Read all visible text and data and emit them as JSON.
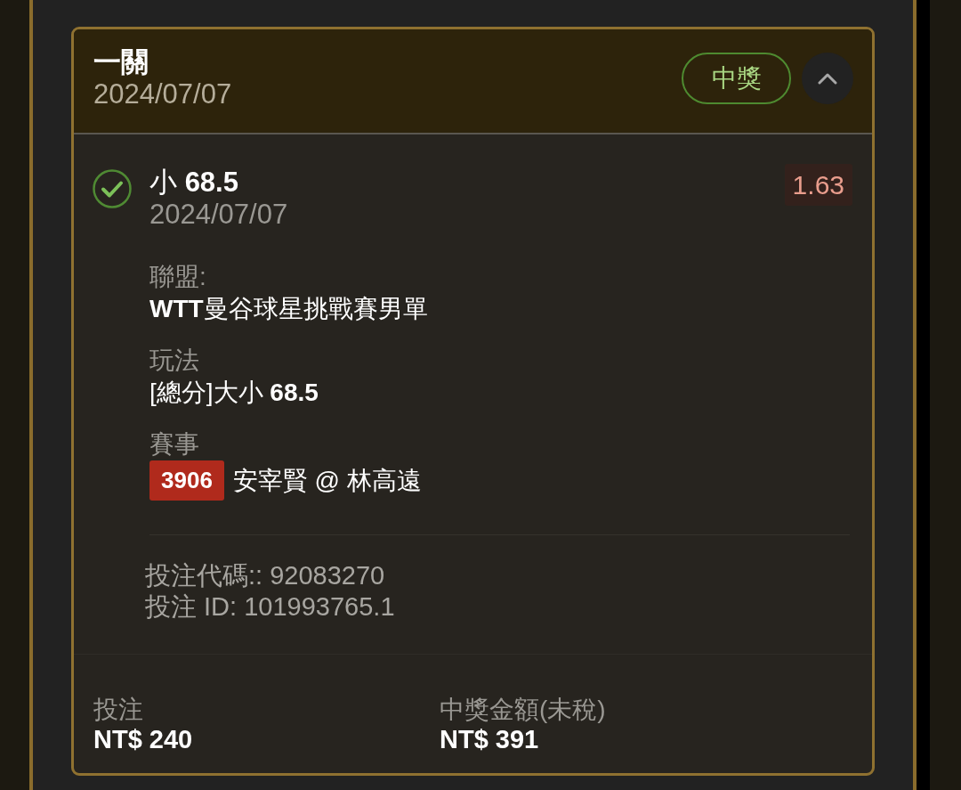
{
  "card": {
    "title": "一關",
    "date": "2024/07/07",
    "status": {
      "label": "中獎",
      "kind": "won"
    },
    "expanded": true
  },
  "selection": {
    "won": true,
    "name": "小 **68.5**",
    "date": "2024/07/07",
    "odds": "1.63"
  },
  "details": [
    {
      "label": "聯盟:",
      "value": "**WTT**曼谷球星挑戰賽男單"
    },
    {
      "label": "玩法",
      "value": "[總分]大小 **68.5**"
    },
    {
      "label": "賽事",
      "event_number": "3906",
      "value": "安宰賢 @ 林高遠"
    }
  ],
  "references": [
    "投注代碼:: 92083270",
    "投注 ID: 101993765.1"
  ],
  "totals": [
    {
      "label": "投注",
      "amount": "NT$ 240"
    },
    {
      "label": "中獎金額(未稅)",
      "amount": "NT$ 391"
    }
  ]
}
